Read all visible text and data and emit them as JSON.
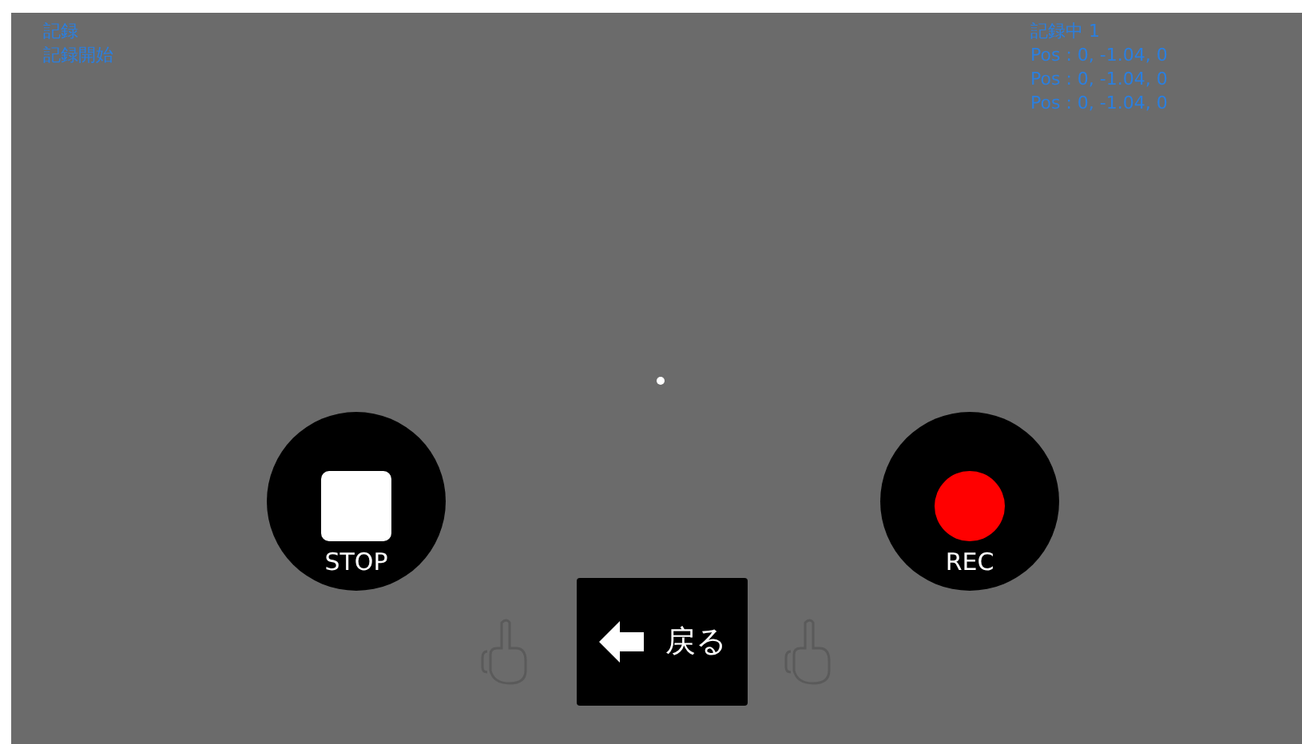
{
  "status_left": [
    "記録",
    "記録開始"
  ],
  "status_right": [
    "記録中 1",
    "Pos : 0, -1.04, 0",
    "Pos : 0, -1.04, 0",
    "Pos : 0, -1.04, 0"
  ],
  "buttons": [
    {
      "kind": "stop",
      "label": "STOP"
    },
    {
      "kind": "rec",
      "label": "REC"
    }
  ],
  "back_button": {
    "label": "戻る"
  }
}
